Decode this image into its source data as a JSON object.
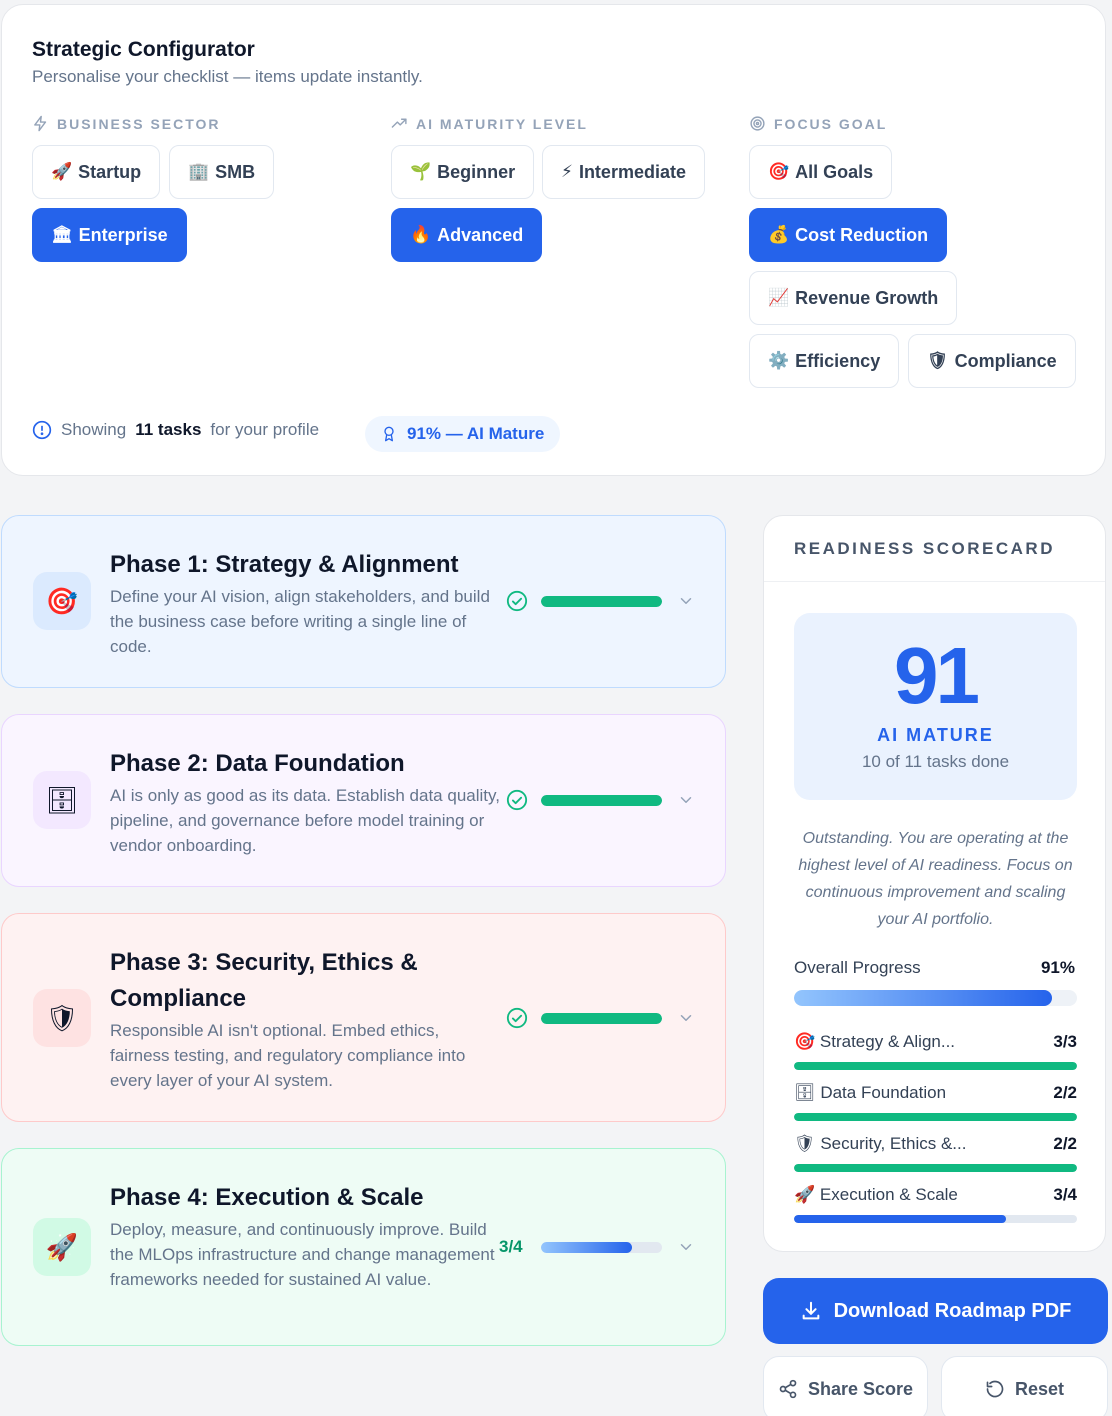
{
  "config": {
    "title": "Strategic Configurator",
    "subtitle": "Personalise your checklist — items update instantly.",
    "sector_heading": "BUSINESS SECTOR",
    "maturity_heading": "AI MATURITY LEVEL",
    "goal_heading": "FOCUS GOAL",
    "sectors": [
      {
        "emoji": "🚀",
        "label": "Startup",
        "active": false
      },
      {
        "emoji": "🏢",
        "label": "SMB",
        "active": false
      },
      {
        "emoji": "🏛",
        "label": "Enterprise",
        "active": true
      }
    ],
    "maturity": [
      {
        "emoji": "🌱",
        "label": "Beginner",
        "active": false
      },
      {
        "emoji": "⚡",
        "label": "Intermediate",
        "active": false
      },
      {
        "emoji": "🔥",
        "label": "Advanced",
        "active": true
      }
    ],
    "goals": [
      {
        "emoji": "🎯",
        "label": "All Goals",
        "active": false
      },
      {
        "emoji": "💰",
        "label": "Cost Reduction",
        "active": true
      },
      {
        "emoji": "📈",
        "label": "Revenue Growth",
        "active": false
      },
      {
        "emoji": "⚙️",
        "label": "Efficiency",
        "active": false
      },
      {
        "emoji": "🛡",
        "label": "Compliance",
        "active": false
      }
    ],
    "showing_prefix": "Showing",
    "showing_count": "11 tasks",
    "showing_suffix": "for your profile",
    "maturity_pill": "91% — AI Mature"
  },
  "phases": [
    {
      "emoji": "🎯",
      "title": "Phase 1: Strategy & Alignment",
      "description": "Define your AI vision, align stakeholders, and build the business case before writing a single line of code.",
      "complete": true,
      "progress": 1.0
    },
    {
      "emoji": "🗄",
      "title": "Phase 2: Data Foundation",
      "description": "AI is only as good as its data. Establish data quality, pipeline, and governance before model training or vendor onboarding.",
      "complete": true,
      "progress": 1.0
    },
    {
      "emoji": "🛡",
      "title": "Phase 3: Security, Ethics & Compliance",
      "description": "Responsible AI isn't optional. Embed ethics, fairness testing, and regulatory compliance into every layer of your AI system.",
      "complete": true,
      "progress": 1.0
    },
    {
      "emoji": "🚀",
      "title": "Phase 4: Execution & Scale",
      "description": "Deploy, measure, and continuously improve. Build the MLOps infrastructure and change management frameworks needed for sustained AI value.",
      "complete": false,
      "count": "3/4",
      "progress": 0.75
    }
  ],
  "scorecard": {
    "heading": "READINESS SCORECARD",
    "score": "91",
    "level": "AI MATURE",
    "tasks_done": "10 of 11 tasks done",
    "quote": "Outstanding. You are operating at the highest level of AI readiness. Focus on continuous improvement and scaling your AI portfolio.",
    "overall_label": "Overall Progress",
    "overall_value": "91%",
    "overall_progress": 0.91,
    "items": [
      {
        "emoji": "🎯",
        "label": "Strategy & Align...",
        "value": "3/3",
        "progress": 1.0
      },
      {
        "emoji": "🗄",
        "label": "Data Foundation",
        "value": "2/2",
        "progress": 1.0
      },
      {
        "emoji": "🛡",
        "label": "Security, Ethics &...",
        "value": "2/2",
        "progress": 1.0
      },
      {
        "emoji": "🚀",
        "label": "Execution & Scale",
        "value": "3/4",
        "progress": 0.75
      }
    ]
  },
  "actions": {
    "download": "Download Roadmap PDF",
    "share": "Share Score",
    "reset": "Reset"
  },
  "colors": {
    "primary": "#2563eb",
    "success": "#10b981",
    "phase1_bg": "#eff6ff",
    "phase2_bg": "#faf5ff",
    "phase3_bg": "#fef2f2",
    "phase4_bg": "#ecfdf5"
  }
}
